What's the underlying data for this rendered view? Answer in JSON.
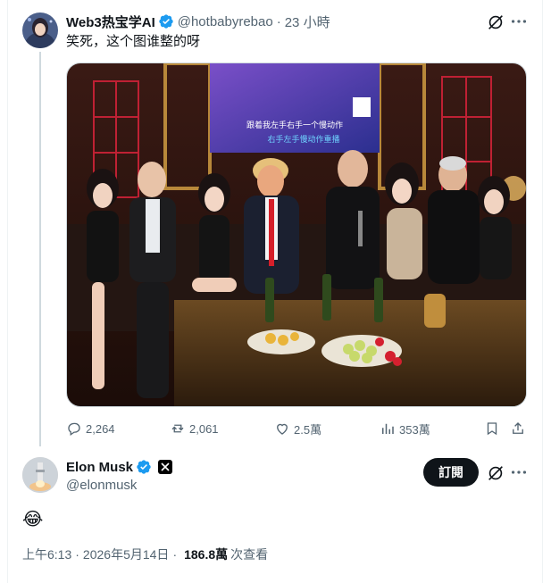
{
  "parent_tweet": {
    "display_name": "Web3热宝学AI",
    "handle": "@hotbabyrebao",
    "separator": "·",
    "time": "23 小時",
    "text": "笑死，这个图谁整的呀",
    "photo_screen_text": [
      "跟着我左手右手一个慢动作",
      "右手左手慢动作重播"
    ],
    "stats": {
      "replies": "2,264",
      "reposts": "2,061",
      "likes": "2.5萬",
      "views": "353萬"
    }
  },
  "main_tweet": {
    "display_name": "Elon Musk",
    "handle": "@elonmusk",
    "subscribe_label": "訂閱",
    "text": "😂",
    "meta": {
      "time": "上午6:13",
      "date": "2026年5月14日",
      "views_count": "186.8萬",
      "views_label": "次查看",
      "separator": "·"
    }
  },
  "colors": {
    "verified": "#1d9bf0",
    "text_primary": "#0f1419",
    "text_secondary": "#536471",
    "button_dark": "#0f1419",
    "thread_line": "#cfd9de"
  },
  "icons": [
    "verified-badge-icon",
    "grok-icon",
    "more-icon",
    "reply-icon",
    "repost-icon",
    "like-icon",
    "views-icon",
    "bookmark-icon",
    "share-icon",
    "x-logo-icon"
  ]
}
